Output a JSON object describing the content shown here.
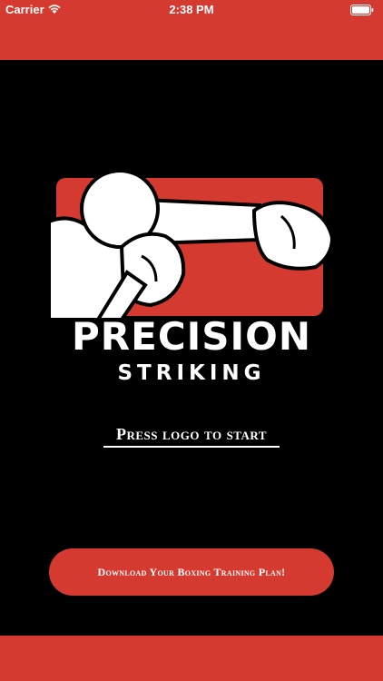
{
  "status_bar": {
    "carrier": "Carrier",
    "time": "2:38 PM",
    "wifi_icon": "wifi-icon",
    "battery_icon": "battery-icon"
  },
  "logo": {
    "title": "PRECISION",
    "subtitle": "STRIKING",
    "icon": "boxer-punch-icon"
  },
  "press_hint": "Press logo to start",
  "download_button": {
    "label": "Download Your Boxing Training Plan!"
  },
  "colors": {
    "accent": "#d43a2f",
    "background": "#000000",
    "text": "#ffffff"
  }
}
